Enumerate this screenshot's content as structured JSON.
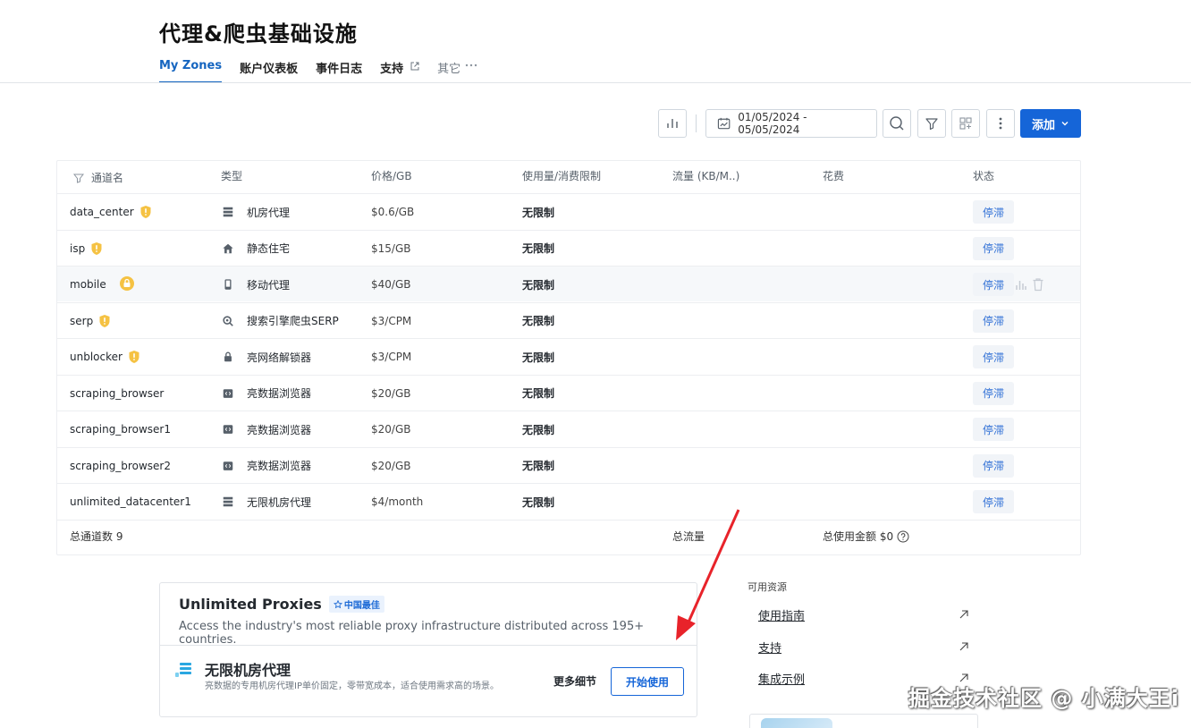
{
  "page_title": "代理&爬虫基础设施",
  "nav": {
    "tabs": [
      {
        "label": "My Zones"
      },
      {
        "label": "账户仪表板"
      },
      {
        "label": "事件日志"
      },
      {
        "label": "支持"
      },
      {
        "label": "其它"
      }
    ]
  },
  "toolbar": {
    "date_range": "01/05/2024 - 05/05/2024",
    "add_label": "添加"
  },
  "table": {
    "headers": {
      "name": "通道名",
      "type": "类型",
      "price": "价格/GB",
      "usage": "使用量/消费限制",
      "traffic": "流量 (KB/M..)",
      "cost": "花费",
      "status": "状态"
    },
    "rows": [
      {
        "name": "data_center",
        "badge": "shield",
        "type_icon": "server-icon",
        "type": "机房代理",
        "price": "$0.6/GB",
        "usage": "无限制",
        "status": "停滞"
      },
      {
        "name": "isp",
        "badge": "shield",
        "type_icon": "home-icon",
        "type": "静态住宅",
        "price": "$15/GB",
        "usage": "无限制",
        "status": "停滞"
      },
      {
        "name": "mobile",
        "badge": "lock",
        "type_icon": "mobile-icon",
        "type": "移动代理",
        "price": "$40/GB",
        "usage": "无限制",
        "status": "停滞"
      },
      {
        "name": "serp",
        "badge": "shield",
        "type_icon": "search-icon",
        "type": "搜索引擎爬虫SERP",
        "price": "$3/CPM",
        "usage": "无限制",
        "status": "停滞"
      },
      {
        "name": "unblocker",
        "badge": "shield",
        "type_icon": "lock-icon",
        "type": "亮网络解锁器",
        "price": "$3/CPM",
        "usage": "无限制",
        "status": "停滞"
      },
      {
        "name": "scraping_browser",
        "badge": "",
        "type_icon": "code-icon",
        "type": "亮数据浏览器",
        "price": "$20/GB",
        "usage": "无限制",
        "status": "停滞"
      },
      {
        "name": "scraping_browser1",
        "badge": "",
        "type_icon": "code-icon",
        "type": "亮数据浏览器",
        "price": "$20/GB",
        "usage": "无限制",
        "status": "停滞"
      },
      {
        "name": "scraping_browser2",
        "badge": "",
        "type_icon": "code-icon",
        "type": "亮数据浏览器",
        "price": "$20/GB",
        "usage": "无限制",
        "status": "停滞"
      },
      {
        "name": "unlimited_datacenter1",
        "badge": "",
        "type_icon": "server-icon",
        "type": "无限机房代理",
        "price": "$4/month",
        "usage": "无限制",
        "status": "停滞"
      }
    ],
    "footer": {
      "total_zones": "总通道数 9",
      "total_traffic": "总流量",
      "total_cost": "总使用金额 $0"
    }
  },
  "promo": {
    "title": "Unlimited Proxies",
    "badge": "中国最佳",
    "desc": "Access the industry's most reliable proxy infrastructure distributed across 195+ countries.",
    "product_title": "无限机房代理",
    "product_desc": "亮数据的专用机房代理IP单价固定，零带宽成本，适合使用需求高的场景。",
    "more_label": "更多细节",
    "start_label": "开始使用"
  },
  "resources": {
    "title": "可用资源",
    "links": [
      {
        "label": "使用指南"
      },
      {
        "label": "支持"
      },
      {
        "label": "集成示例"
      }
    ]
  },
  "watermark": "掘金技术社区 @ 小满大王i",
  "colors": {
    "accent": "#1565d8",
    "status_text": "#2f6fd6",
    "shield": "#f5c243"
  }
}
